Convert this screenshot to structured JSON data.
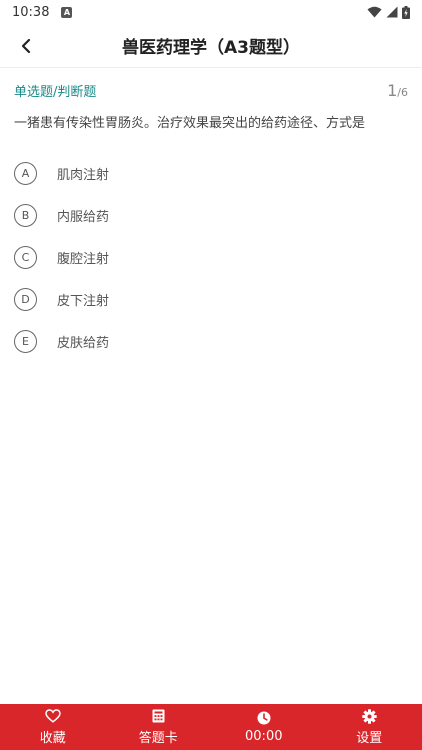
{
  "status_bar": {
    "time": "10:38",
    "notification_icon": "a-icon"
  },
  "header": {
    "title": "兽医药理学（A3题型）",
    "back_icon": "chevron-left-icon"
  },
  "question": {
    "type": "单选题/判断题",
    "current": "1",
    "total": "/6",
    "text": "一猪患有传染性胃肠炎。治疗效果最突出的给药途径、方式是",
    "options": [
      {
        "letter": "A",
        "text": "肌肉注射"
      },
      {
        "letter": "B",
        "text": "内服给药"
      },
      {
        "letter": "C",
        "text": "腹腔注射"
      },
      {
        "letter": "D",
        "text": "皮下注射"
      },
      {
        "letter": "E",
        "text": "皮肤给药"
      }
    ]
  },
  "bottom_bar": {
    "favorite": {
      "label": "收藏",
      "icon": "heart-icon"
    },
    "answer_card": {
      "label": "答题卡",
      "icon": "calculator-icon"
    },
    "timer": {
      "label": "00:00",
      "icon": "clock-icon"
    },
    "settings": {
      "label": "设置",
      "icon": "gear-icon"
    }
  },
  "colors": {
    "accent": "#d9262b",
    "type_label": "#1a8a8a"
  }
}
